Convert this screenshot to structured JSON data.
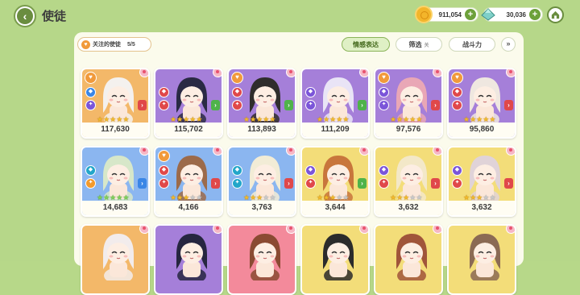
{
  "header": {
    "title": "使徒",
    "back_icon": "back-arrow-icon",
    "home_icon": "home-icon"
  },
  "currencies": [
    {
      "name": "coin",
      "value": "911,054",
      "plus": "+"
    },
    {
      "name": "gem",
      "value": "30,036",
      "plus": "+"
    }
  ],
  "toolbar": {
    "followed_label": "关注的使徒",
    "followed_count": "5/5",
    "emotion_label": "情感表达",
    "filter_label": "筛选",
    "filter_state": "关",
    "power_label": "战斗力",
    "sort_icon": "double-chevron-down-icon"
  },
  "cards": [
    {
      "power": "117,630",
      "bg": "#f3b869",
      "hair": "#f4f1ee",
      "rar": "gold",
      "stars": [
        1,
        1,
        1,
        1,
        1
      ],
      "heart": true,
      "b1": "blue",
      "b2": "purple",
      "arrow": "red"
    },
    {
      "power": "115,702",
      "bg": "#a57fd9",
      "hair": "#2a2a44",
      "rar": "gold",
      "stars": [
        1,
        1,
        1,
        1,
        1
      ],
      "heart": false,
      "b1": "red",
      "b2": "red",
      "arrow": "green"
    },
    {
      "power": "113,893",
      "bg": "#a57fd9",
      "hair": "#2f2d2c",
      "rar": "gold",
      "stars": [
        1,
        1,
        1,
        1,
        1
      ],
      "heart": true,
      "b1": "red",
      "b2": "red",
      "arrow": "green"
    },
    {
      "power": "111,209",
      "bg": "#a57fd9",
      "hair": "#e9e4f6",
      "rar": "gold",
      "stars": [
        1,
        1,
        1,
        1,
        1
      ],
      "heart": false,
      "b1": "purple",
      "b2": "purple",
      "arrow": "green"
    },
    {
      "power": "97,576",
      "bg": "#a57fd9",
      "hair": "#e9a7b6",
      "rar": "gold",
      "stars": [
        1,
        1,
        1,
        1,
        1
      ],
      "heart": true,
      "b1": "purple",
      "b2": "purple",
      "arrow": "red"
    },
    {
      "power": "95,860",
      "bg": "#a57fd9",
      "hair": "#efe7e0",
      "rar": "gold",
      "stars": [
        1,
        1,
        1,
        1,
        1
      ],
      "heart": true,
      "b1": "red",
      "b2": "red",
      "arrow": "red"
    },
    {
      "power": "14,683",
      "bg": "#8bb6f0",
      "hair": "#d7e7c9",
      "rar": "green",
      "stars": [
        1,
        1,
        1,
        1,
        1
      ],
      "heart": false,
      "b1": "teal",
      "b2": "orange",
      "arrow": "blue"
    },
    {
      "power": "4,166",
      "bg": "#8bb6f0",
      "hair": "#9c6a4a",
      "rar": "gold",
      "stars": [
        1,
        1,
        1,
        0,
        0
      ],
      "heart": true,
      "b1": "red",
      "b2": "red",
      "arrow": "red"
    },
    {
      "power": "3,763",
      "bg": "#8bb6f0",
      "hair": "#f2ecd6",
      "rar": "gold",
      "stars": [
        1,
        1,
        1,
        0,
        0
      ],
      "heart": false,
      "b1": "teal",
      "b2": "teal",
      "arrow": "red"
    },
    {
      "power": "3,644",
      "bg": "#f3dd79",
      "hair": "#c8763c",
      "rar": "gold",
      "stars": [
        1,
        1,
        1,
        0,
        0
      ],
      "heart": false,
      "b1": "purple",
      "b2": "red",
      "arrow": "green"
    },
    {
      "power": "3,632",
      "bg": "#f3dd79",
      "hair": "#f3e8c8",
      "rar": "gold",
      "stars": [
        1,
        1,
        1,
        0,
        0
      ],
      "heart": false,
      "b1": "purple",
      "b2": "red",
      "arrow": "red"
    },
    {
      "power": "3,632",
      "bg": "#f3dd79",
      "hair": "#e0d3d8",
      "rar": "gold",
      "stars": [
        1,
        1,
        1,
        0,
        0
      ],
      "heart": false,
      "b1": "purple",
      "b2": "red",
      "arrow": "red"
    },
    {
      "power": "",
      "bg": "#f3b869",
      "hair": "#f2ecec",
      "rar": "gold",
      "stars": [],
      "heart": false,
      "b1": "",
      "b2": "",
      "arrow": ""
    },
    {
      "power": "",
      "bg": "#a57fd9",
      "hair": "#262640",
      "rar": "gold",
      "stars": [],
      "heart": false,
      "b1": "",
      "b2": "",
      "arrow": ""
    },
    {
      "power": "",
      "bg": "#f38a9b",
      "hair": "#8a4a32",
      "rar": "gold",
      "stars": [],
      "heart": false,
      "b1": "",
      "b2": "",
      "arrow": ""
    },
    {
      "power": "",
      "bg": "#f3dd79",
      "hair": "#2b2b2b",
      "rar": "gold",
      "stars": [],
      "heart": false,
      "b1": "",
      "b2": "",
      "arrow": ""
    },
    {
      "power": "",
      "bg": "#f3dd79",
      "hair": "#a0553a",
      "rar": "gold",
      "stars": [],
      "heart": false,
      "b1": "",
      "b2": "",
      "arrow": ""
    },
    {
      "power": "",
      "bg": "#f3dd79",
      "hair": "#8b6a54",
      "rar": "gold",
      "stars": [],
      "heart": false,
      "b1": "",
      "b2": "",
      "arrow": ""
    }
  ]
}
